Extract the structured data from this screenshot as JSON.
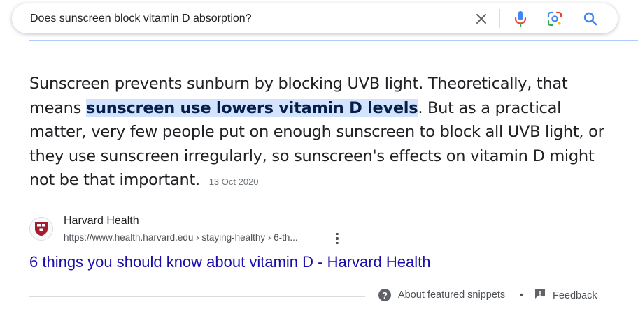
{
  "search": {
    "query": "Does sunscreen block vitamin D absorption?"
  },
  "snippet": {
    "text_1": "Sunscreen prevents sunburn by blocking ",
    "term_uvb": "UVB light",
    "text_2": ". Theoretically, that means ",
    "highlight": "sunscreen use lowers vitamin D levels",
    "text_3": ". But as a practical matter, very few people put on enough sunscreen to block all UVB light, or they use sunscreen irregularly, so sunscreen's effects on vitamin D might not be that important.",
    "date": "13 Oct 2020"
  },
  "source": {
    "name": "Harvard Health",
    "url": "https://www.health.harvard.edu › staying-healthy › 6-th...",
    "title": "6 things you should know about vitamin D - Harvard Health"
  },
  "footer": {
    "about_label": "About featured snippets",
    "separator": "•",
    "feedback_label": "Feedback"
  },
  "colors": {
    "link": "#1a0dab",
    "highlight_bg": "#d3e3fd",
    "crest_red": "#a51c30"
  }
}
